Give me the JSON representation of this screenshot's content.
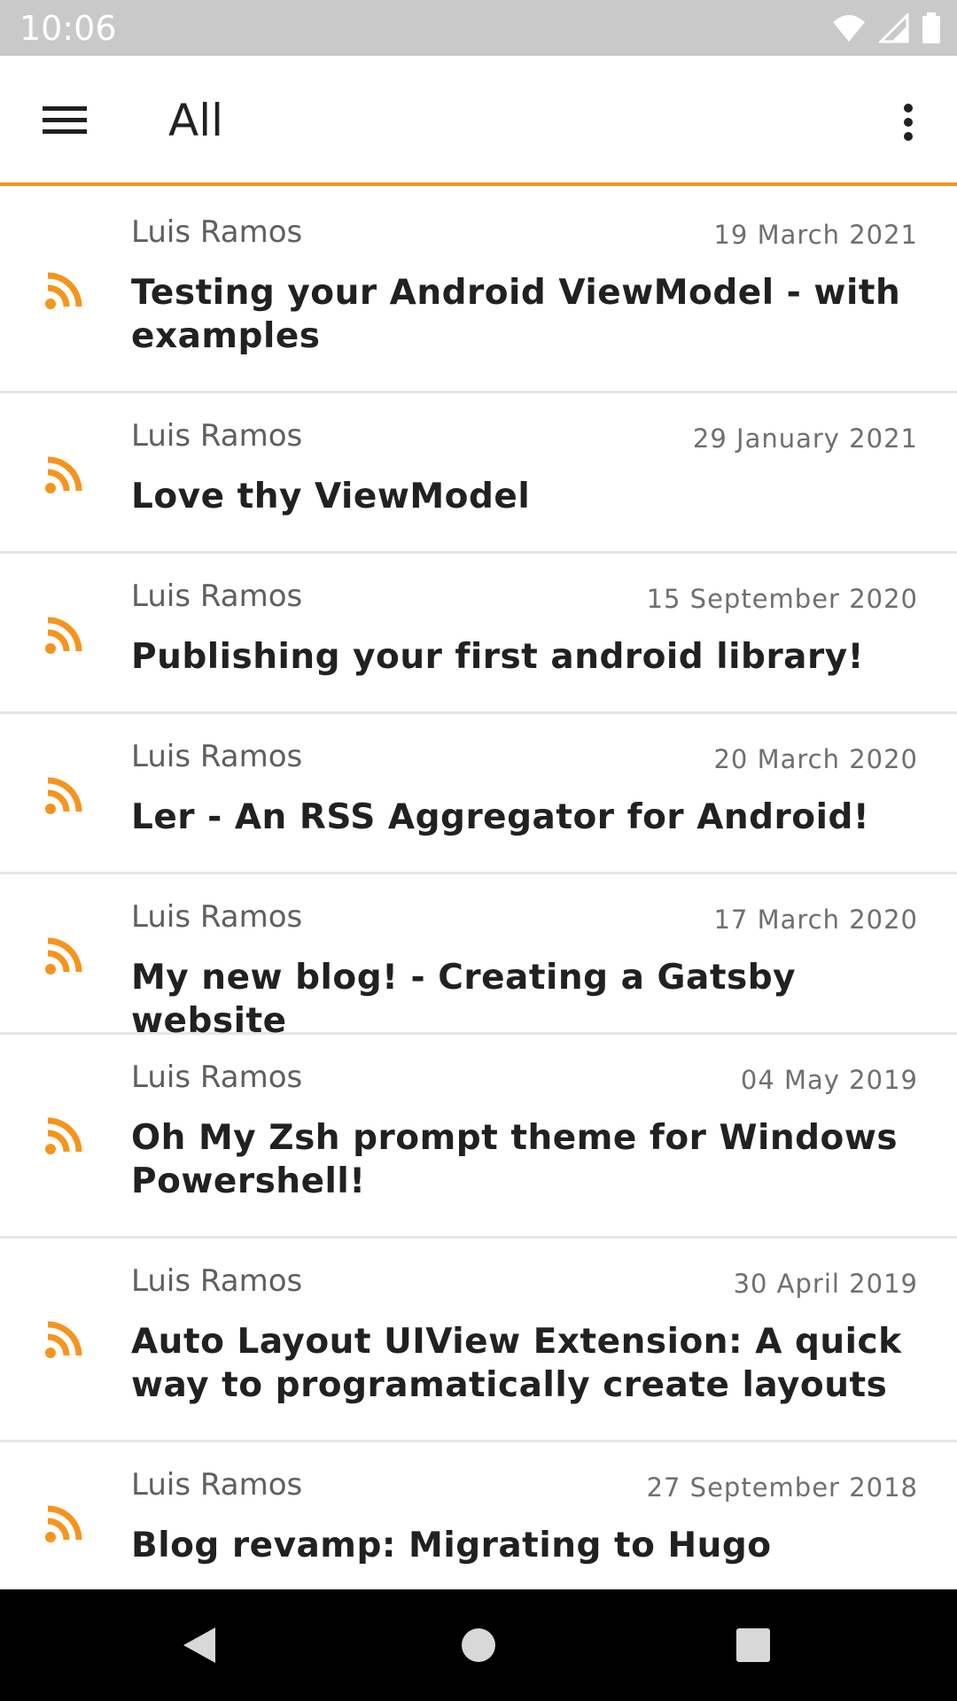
{
  "status_bar": {
    "time": "10:06",
    "icons": [
      "wifi-icon",
      "signal-icon",
      "battery-icon"
    ]
  },
  "app_bar": {
    "title": "All",
    "menu_icon": "hamburger-menu-icon",
    "overflow_icon": "more-vert-icon",
    "accent_color": "#f6941d"
  },
  "feed": {
    "icon": "rss-icon",
    "icon_color": "#f6941d",
    "items": [
      {
        "author": "Luis Ramos",
        "date": "19 March 2021",
        "title": "Testing your Android ViewModel - with examples"
      },
      {
        "author": "Luis Ramos",
        "date": "29 January 2021",
        "title": "Love thy ViewModel"
      },
      {
        "author": "Luis Ramos",
        "date": "15 September 2020",
        "title": "Publishing your first android library!"
      },
      {
        "author": "Luis Ramos",
        "date": "20 March 2020",
        "title": "Ler - An RSS Aggregator for Android!"
      },
      {
        "author": "Luis Ramos",
        "date": "17 March 2020",
        "title": "My new blog! - Creating a Gatsby website"
      },
      {
        "author": "Luis Ramos",
        "date": "04 May 2019",
        "title": "Oh My Zsh prompt theme for Windows Powershell!"
      },
      {
        "author": "Luis Ramos",
        "date": "30 April 2019",
        "title": "Auto Layout UIView Extension: A quick way to programatically create layouts"
      },
      {
        "author": "Luis Ramos",
        "date": "27 September 2018",
        "title": "Blog revamp: Migrating to Hugo"
      }
    ]
  },
  "nav_bar": {
    "buttons": [
      "back-icon",
      "home-icon",
      "recents-icon"
    ]
  }
}
